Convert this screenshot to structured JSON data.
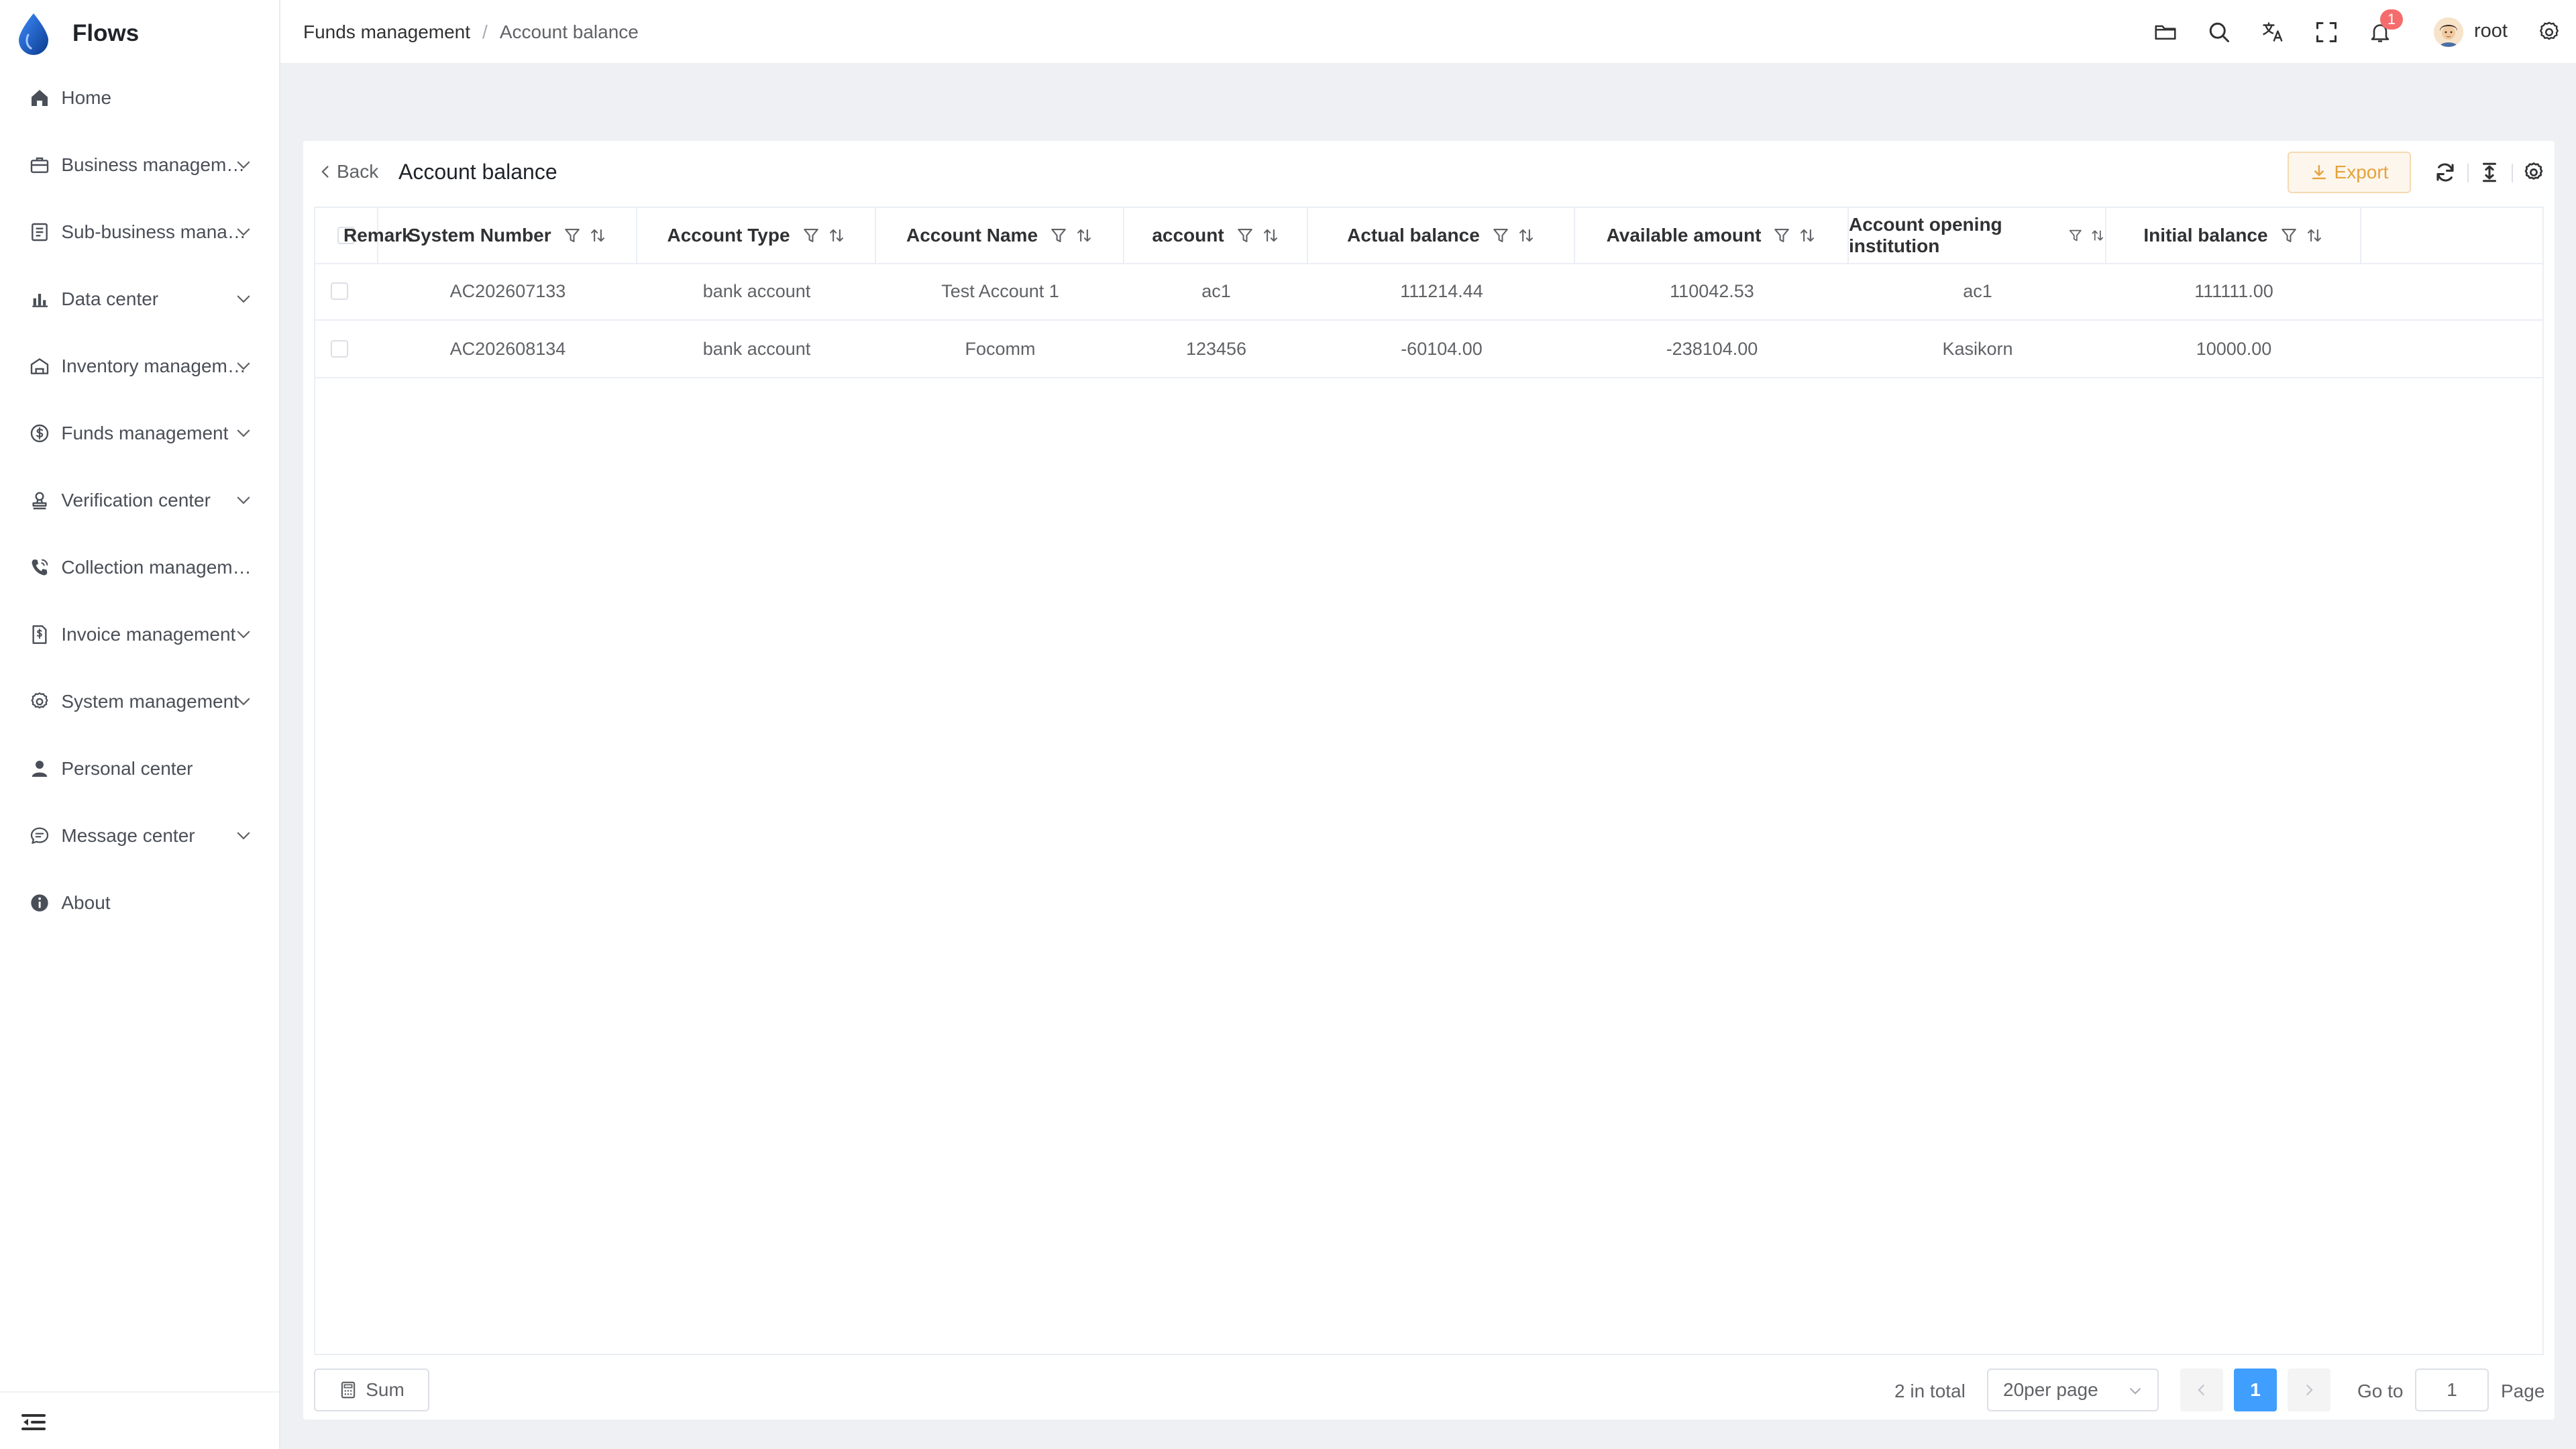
{
  "app": {
    "name": "Flows"
  },
  "colors": {
    "accent": "#409eff",
    "warning": "#e6a23c",
    "badge": "#f56c6c"
  },
  "sidebar": {
    "items": [
      {
        "label": "Home",
        "icon": "home-icon",
        "has_children": false
      },
      {
        "label": "Business management",
        "icon": "briefcase-icon",
        "has_children": true
      },
      {
        "label": "Sub-business management",
        "icon": "document-icon",
        "has_children": true
      },
      {
        "label": "Data center",
        "icon": "bar-chart-icon",
        "has_children": true
      },
      {
        "label": "Inventory management",
        "icon": "warehouse-icon",
        "has_children": true
      },
      {
        "label": "Funds management",
        "icon": "dollar-circle-icon",
        "has_children": true
      },
      {
        "label": "Verification center",
        "icon": "stamp-icon",
        "has_children": true
      },
      {
        "label": "Collection management",
        "icon": "phone-icon",
        "has_children": false
      },
      {
        "label": "Invoice management",
        "icon": "invoice-icon",
        "has_children": true
      },
      {
        "label": "System management",
        "icon": "gear-icon",
        "has_children": true
      },
      {
        "label": "Personal center",
        "icon": "user-icon",
        "has_children": false
      },
      {
        "label": "Message center",
        "icon": "chat-icon",
        "has_children": true
      },
      {
        "label": "About",
        "icon": "info-icon",
        "has_children": false
      }
    ]
  },
  "header": {
    "breadcrumb": [
      "Funds management",
      "Account balance"
    ],
    "separator": "/",
    "notification_count": "1",
    "username": "root"
  },
  "page": {
    "back_label": "Back",
    "title": "Account balance",
    "export_label": "Export"
  },
  "table": {
    "columns": [
      "System Number",
      "Account Type",
      "Account Name",
      "account",
      "Actual balance",
      "Available amount",
      "Account opening institution",
      "Initial balance",
      "Remark"
    ],
    "rows": [
      [
        "AC202607133",
        "bank account",
        "Test Account 1",
        "ac1",
        "111214.44",
        "110042.53",
        "ac1",
        "111111.00",
        ""
      ],
      [
        "AC202608134",
        "bank account",
        "Focomm",
        "123456",
        "-60104.00",
        "-238104.00",
        "Kasikorn",
        "10000.00",
        ""
      ]
    ]
  },
  "footer": {
    "sum_label": "Sum",
    "total_text": "2 in total",
    "page_size": "20per page",
    "current_page": "1",
    "goto_label": "Go to",
    "goto_value": "1",
    "page_label": "Page"
  }
}
